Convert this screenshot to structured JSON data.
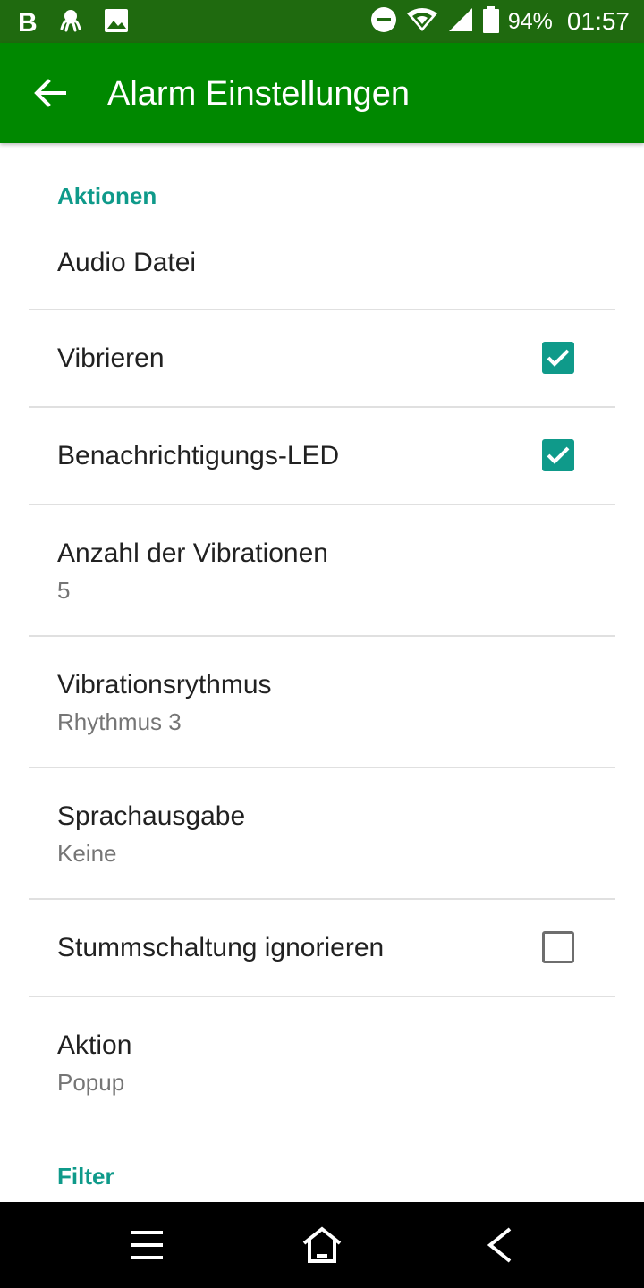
{
  "status_bar": {
    "left_icons": [
      "b-app-icon",
      "octopus-app-icon",
      "image-icon"
    ],
    "letter": "B",
    "battery": "94%",
    "time": "01:57",
    "right_icons": [
      "do-not-disturb-icon",
      "wifi-icon",
      "signal-icon",
      "battery-icon"
    ]
  },
  "app_bar": {
    "title": "Alarm Einstellungen",
    "back_icon": "arrow-left-icon",
    "color": "#008800"
  },
  "sections": {
    "actions_header": "Aktionen",
    "filter_header": "Filter"
  },
  "settings": {
    "audio": {
      "label": "Audio Datei"
    },
    "vibrate": {
      "label": "Vibrieren",
      "checked": true
    },
    "led": {
      "label": "Benachrichtigungs-LED",
      "checked": true
    },
    "vib_count": {
      "label": "Anzahl der Vibrationen",
      "value": "5"
    },
    "vib_rhythm": {
      "label": "Vibrationsrythmus",
      "value": "Rhythmus 3"
    },
    "speech": {
      "label": "Sprachausgabe",
      "value": "Keine"
    },
    "ignore_mute": {
      "label": "Stummschaltung ignorieren",
      "checked": false
    },
    "action": {
      "label": "Aktion",
      "value": "Popup"
    }
  },
  "accent_color": "#0f9a8a",
  "nav_bar": {
    "icons": [
      "menu-icon",
      "home-icon",
      "back-icon"
    ]
  }
}
